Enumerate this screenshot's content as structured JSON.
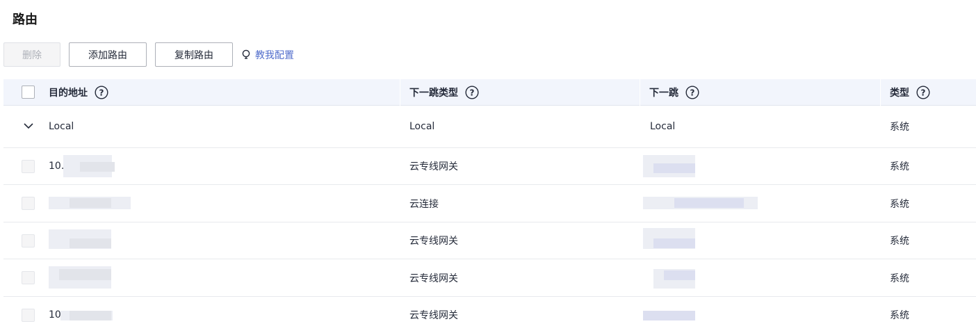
{
  "page": {
    "title": "路由"
  },
  "toolbar": {
    "delete_label": "删除",
    "add_label": "添加路由",
    "copy_label": "复制路由",
    "guide_label": "教我配置"
  },
  "table": {
    "headers": {
      "destination": "目的地址",
      "next_hop_type": "下一跳类型",
      "next_hop": "下一跳",
      "type": "类型"
    },
    "local_row": {
      "destination": "Local",
      "next_hop_type": "Local",
      "next_hop": "Local",
      "type": "系统"
    },
    "rows": [
      {
        "destination": "10.",
        "next_hop_type": "云专线网关",
        "type": "系统"
      },
      {
        "destination": "",
        "next_hop_type": "云连接",
        "type": "系统"
      },
      {
        "destination": "",
        "next_hop_type": "云专线网关",
        "type": "系统"
      },
      {
        "destination": "",
        "next_hop_type": "云专线网关",
        "type": "系统"
      },
      {
        "destination": "10",
        "next_hop_type": "云专线网关",
        "type": "系统"
      }
    ]
  },
  "colors": {
    "accent": "#526ecc",
    "header_bg": "#f2f5fc",
    "border": "#adb0b8"
  },
  "icons": {
    "help": "question-circle-icon",
    "guide": "lightbulb-icon",
    "expand": "chevron-down-icon"
  }
}
